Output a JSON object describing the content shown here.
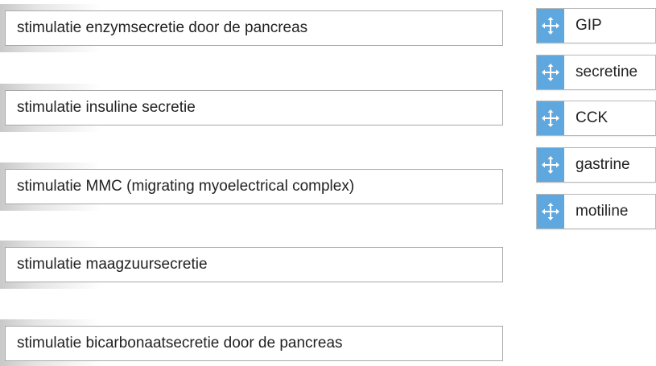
{
  "questions": [
    {
      "text": "stimulatie enzymsecretie door de pancreas"
    },
    {
      "text": "stimulatie insuline secretie"
    },
    {
      "text": "stimulatie MMC (migrating myoelectrical complex)"
    },
    {
      "text": "stimulatie maagzuursecretie"
    },
    {
      "text": "stimulatie bicarbonaatsecretie door de pancreas"
    }
  ],
  "options": [
    {
      "label": "GIP",
      "icon": "move-icon"
    },
    {
      "label": "secretine",
      "icon": "move-icon"
    },
    {
      "label": "CCK",
      "icon": "move-icon"
    },
    {
      "label": "gastrine",
      "icon": "move-icon"
    },
    {
      "label": "motiline",
      "icon": "move-icon"
    }
  ],
  "colors": {
    "handle": "#5ea8df",
    "border": "#a8a8a8",
    "text": "#222222"
  }
}
